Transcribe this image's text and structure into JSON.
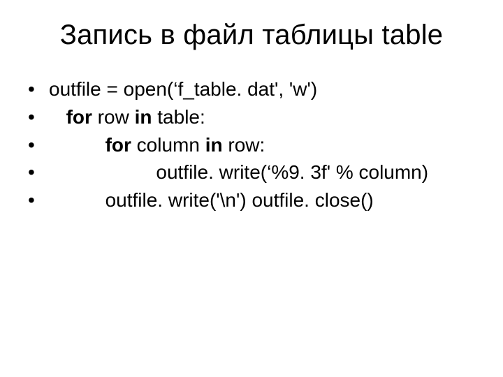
{
  "title": "Запись в файл таблицы table",
  "items": {
    "l1": {
      "t1": "outfile = open(‘f_table. dat', 'w')"
    },
    "l2": {
      "t1": "for",
      "t2": " row ",
      "t3": "in",
      "t4": " table:"
    },
    "l3": {
      "t1": "for",
      "t2": " column ",
      "t3": "in",
      "t4": " row:"
    },
    "l4": {
      "t1": "outfile. write(‘%9. 3f'  % column)"
    },
    "l5": {
      "t1": "outfile. write('\\n') outfile. close()"
    }
  }
}
